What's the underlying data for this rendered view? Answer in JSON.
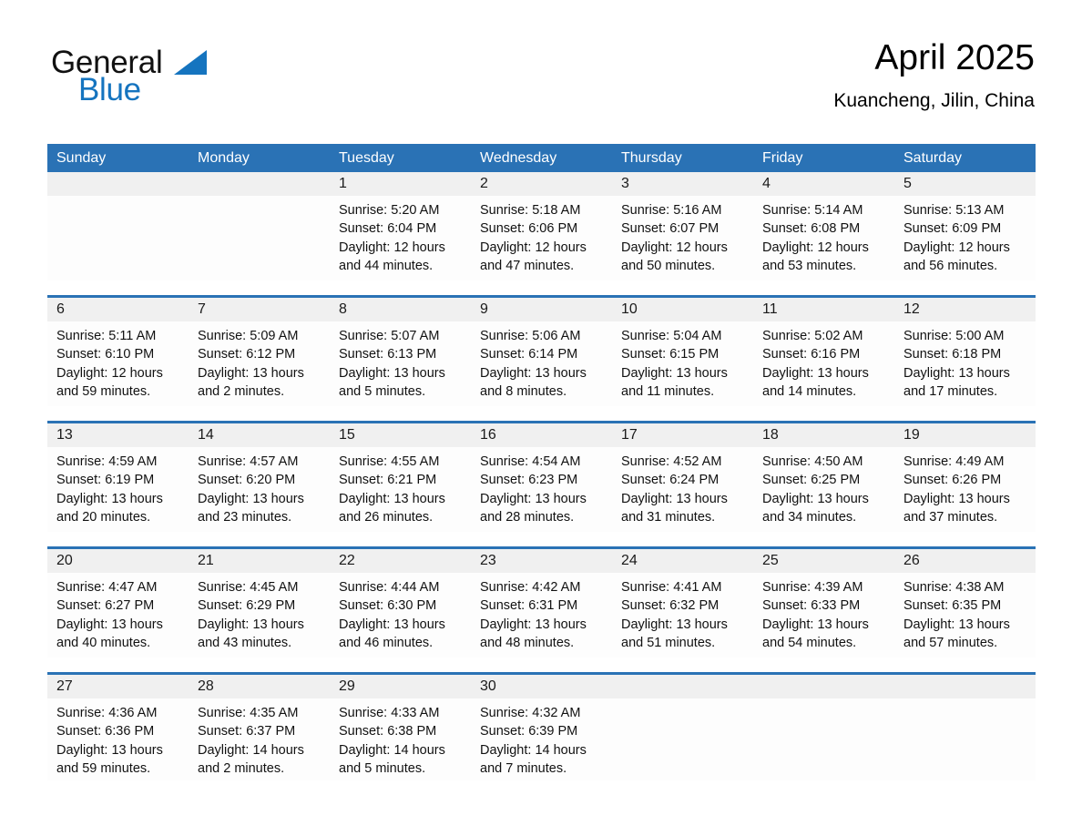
{
  "brand": {
    "name_part1": "General",
    "name_part2": "Blue",
    "accent_color": "#1574bf",
    "triangle_icon": "brand-triangle-icon"
  },
  "header": {
    "title": "April 2025",
    "location": "Kuancheng, Jilin, China"
  },
  "theme": {
    "header_blue": "#2a72b5",
    "day_band_gray": "#f0f0f0",
    "cell_white": "#fdfdfd"
  },
  "weekdays": [
    "Sunday",
    "Monday",
    "Tuesday",
    "Wednesday",
    "Thursday",
    "Friday",
    "Saturday"
  ],
  "weeks": [
    [
      {
        "empty": true
      },
      {
        "empty": true
      },
      {
        "day": "1",
        "sunrise": "Sunrise: 5:20 AM",
        "sunset": "Sunset: 6:04 PM",
        "daylight": "Daylight: 12 hours and 44 minutes."
      },
      {
        "day": "2",
        "sunrise": "Sunrise: 5:18 AM",
        "sunset": "Sunset: 6:06 PM",
        "daylight": "Daylight: 12 hours and 47 minutes."
      },
      {
        "day": "3",
        "sunrise": "Sunrise: 5:16 AM",
        "sunset": "Sunset: 6:07 PM",
        "daylight": "Daylight: 12 hours and 50 minutes."
      },
      {
        "day": "4",
        "sunrise": "Sunrise: 5:14 AM",
        "sunset": "Sunset: 6:08 PM",
        "daylight": "Daylight: 12 hours and 53 minutes."
      },
      {
        "day": "5",
        "sunrise": "Sunrise: 5:13 AM",
        "sunset": "Sunset: 6:09 PM",
        "daylight": "Daylight: 12 hours and 56 minutes."
      }
    ],
    [
      {
        "day": "6",
        "sunrise": "Sunrise: 5:11 AM",
        "sunset": "Sunset: 6:10 PM",
        "daylight": "Daylight: 12 hours and 59 minutes."
      },
      {
        "day": "7",
        "sunrise": "Sunrise: 5:09 AM",
        "sunset": "Sunset: 6:12 PM",
        "daylight": "Daylight: 13 hours and 2 minutes."
      },
      {
        "day": "8",
        "sunrise": "Sunrise: 5:07 AM",
        "sunset": "Sunset: 6:13 PM",
        "daylight": "Daylight: 13 hours and 5 minutes."
      },
      {
        "day": "9",
        "sunrise": "Sunrise: 5:06 AM",
        "sunset": "Sunset: 6:14 PM",
        "daylight": "Daylight: 13 hours and 8 minutes."
      },
      {
        "day": "10",
        "sunrise": "Sunrise: 5:04 AM",
        "sunset": "Sunset: 6:15 PM",
        "daylight": "Daylight: 13 hours and 11 minutes."
      },
      {
        "day": "11",
        "sunrise": "Sunrise: 5:02 AM",
        "sunset": "Sunset: 6:16 PM",
        "daylight": "Daylight: 13 hours and 14 minutes."
      },
      {
        "day": "12",
        "sunrise": "Sunrise: 5:00 AM",
        "sunset": "Sunset: 6:18 PM",
        "daylight": "Daylight: 13 hours and 17 minutes."
      }
    ],
    [
      {
        "day": "13",
        "sunrise": "Sunrise: 4:59 AM",
        "sunset": "Sunset: 6:19 PM",
        "daylight": "Daylight: 13 hours and 20 minutes."
      },
      {
        "day": "14",
        "sunrise": "Sunrise: 4:57 AM",
        "sunset": "Sunset: 6:20 PM",
        "daylight": "Daylight: 13 hours and 23 minutes."
      },
      {
        "day": "15",
        "sunrise": "Sunrise: 4:55 AM",
        "sunset": "Sunset: 6:21 PM",
        "daylight": "Daylight: 13 hours and 26 minutes."
      },
      {
        "day": "16",
        "sunrise": "Sunrise: 4:54 AM",
        "sunset": "Sunset: 6:23 PM",
        "daylight": "Daylight: 13 hours and 28 minutes."
      },
      {
        "day": "17",
        "sunrise": "Sunrise: 4:52 AM",
        "sunset": "Sunset: 6:24 PM",
        "daylight": "Daylight: 13 hours and 31 minutes."
      },
      {
        "day": "18",
        "sunrise": "Sunrise: 4:50 AM",
        "sunset": "Sunset: 6:25 PM",
        "daylight": "Daylight: 13 hours and 34 minutes."
      },
      {
        "day": "19",
        "sunrise": "Sunrise: 4:49 AM",
        "sunset": "Sunset: 6:26 PM",
        "daylight": "Daylight: 13 hours and 37 minutes."
      }
    ],
    [
      {
        "day": "20",
        "sunrise": "Sunrise: 4:47 AM",
        "sunset": "Sunset: 6:27 PM",
        "daylight": "Daylight: 13 hours and 40 minutes."
      },
      {
        "day": "21",
        "sunrise": "Sunrise: 4:45 AM",
        "sunset": "Sunset: 6:29 PM",
        "daylight": "Daylight: 13 hours and 43 minutes."
      },
      {
        "day": "22",
        "sunrise": "Sunrise: 4:44 AM",
        "sunset": "Sunset: 6:30 PM",
        "daylight": "Daylight: 13 hours and 46 minutes."
      },
      {
        "day": "23",
        "sunrise": "Sunrise: 4:42 AM",
        "sunset": "Sunset: 6:31 PM",
        "daylight": "Daylight: 13 hours and 48 minutes."
      },
      {
        "day": "24",
        "sunrise": "Sunrise: 4:41 AM",
        "sunset": "Sunset: 6:32 PM",
        "daylight": "Daylight: 13 hours and 51 minutes."
      },
      {
        "day": "25",
        "sunrise": "Sunrise: 4:39 AM",
        "sunset": "Sunset: 6:33 PM",
        "daylight": "Daylight: 13 hours and 54 minutes."
      },
      {
        "day": "26",
        "sunrise": "Sunrise: 4:38 AM",
        "sunset": "Sunset: 6:35 PM",
        "daylight": "Daylight: 13 hours and 57 minutes."
      }
    ],
    [
      {
        "day": "27",
        "sunrise": "Sunrise: 4:36 AM",
        "sunset": "Sunset: 6:36 PM",
        "daylight": "Daylight: 13 hours and 59 minutes."
      },
      {
        "day": "28",
        "sunrise": "Sunrise: 4:35 AM",
        "sunset": "Sunset: 6:37 PM",
        "daylight": "Daylight: 14 hours and 2 minutes."
      },
      {
        "day": "29",
        "sunrise": "Sunrise: 4:33 AM",
        "sunset": "Sunset: 6:38 PM",
        "daylight": "Daylight: 14 hours and 5 minutes."
      },
      {
        "day": "30",
        "sunrise": "Sunrise: 4:32 AM",
        "sunset": "Sunset: 6:39 PM",
        "daylight": "Daylight: 14 hours and 7 minutes."
      },
      {
        "empty": true
      },
      {
        "empty": true
      },
      {
        "empty": true
      }
    ]
  ]
}
